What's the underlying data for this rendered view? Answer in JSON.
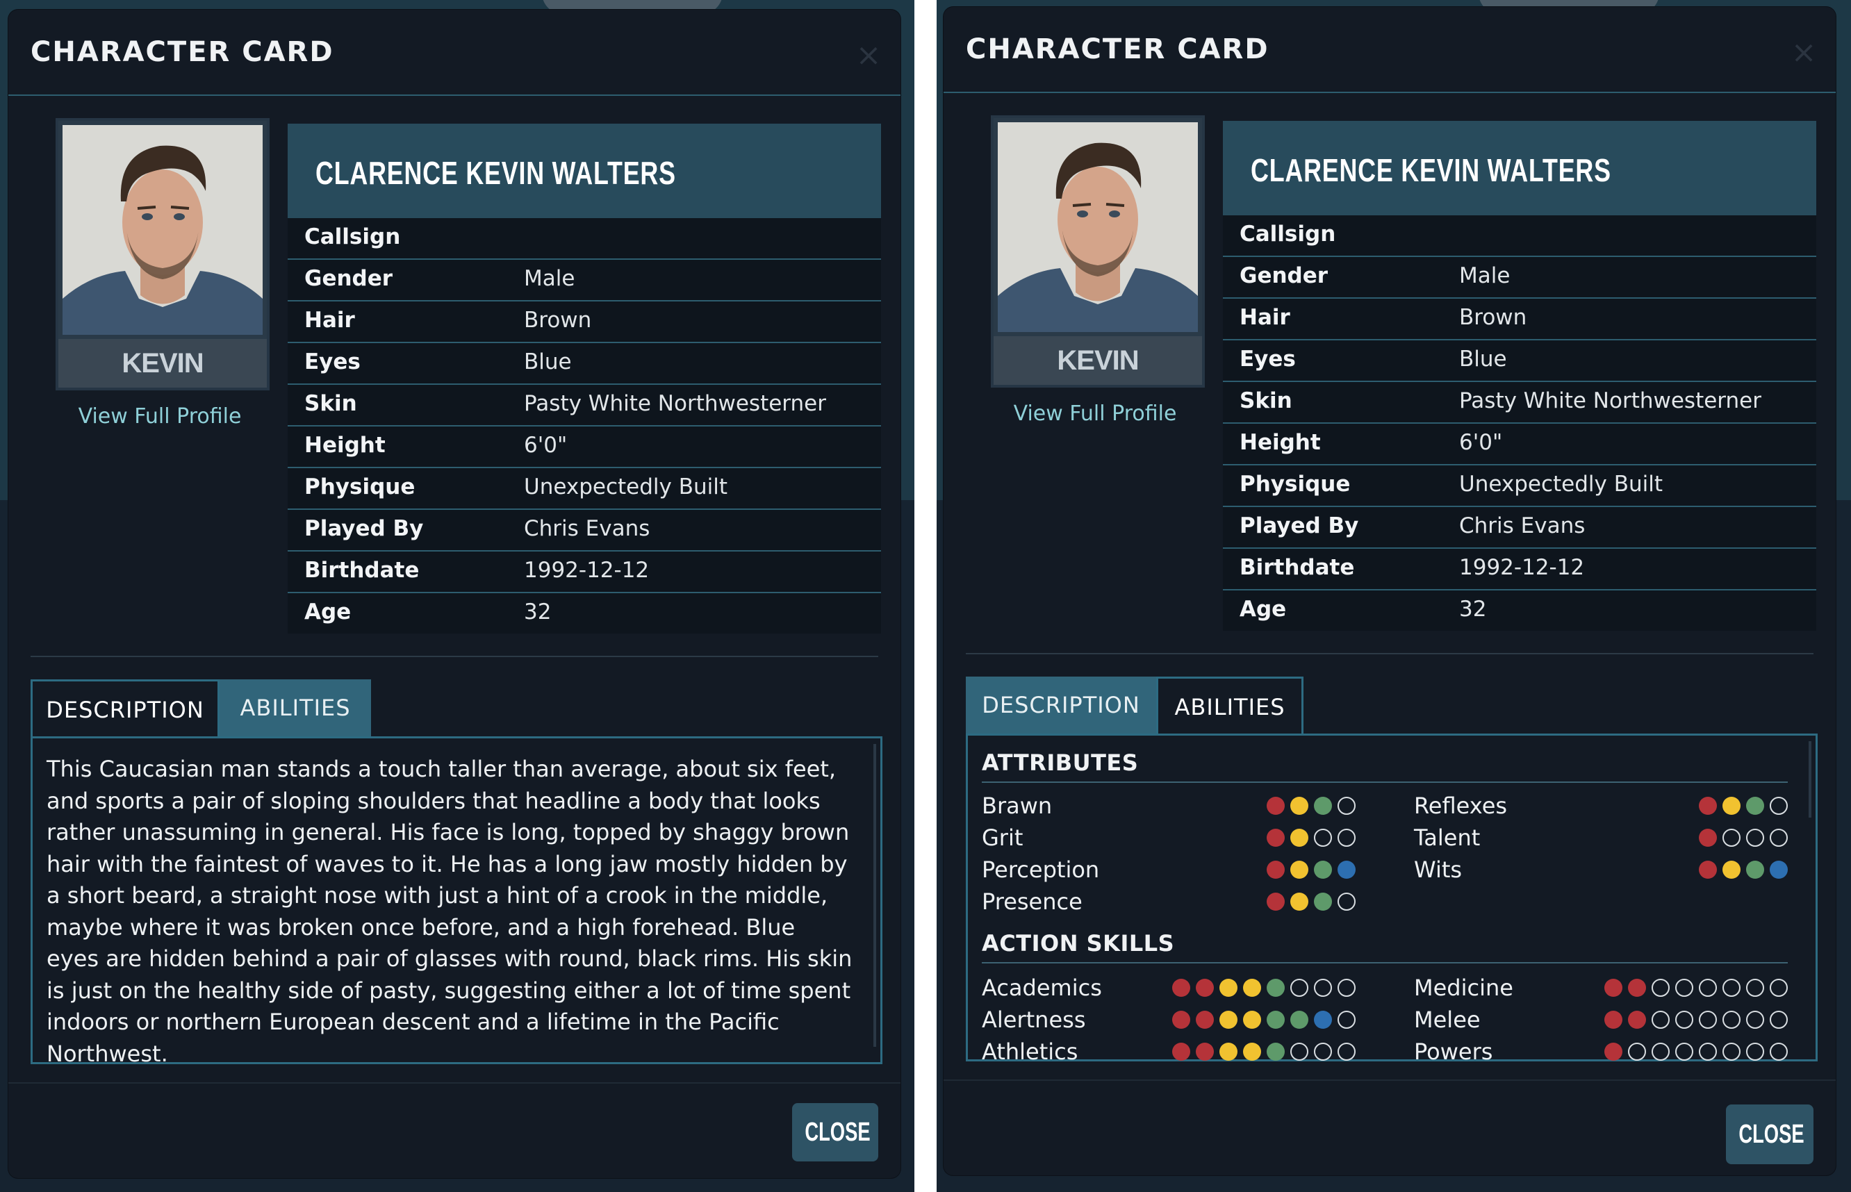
{
  "card": {
    "title": "CHARACTER CARD",
    "close_icon": "×",
    "nickname": "KEVIN",
    "view_profile": "View Full Profile",
    "name": "CLARENCE KEVIN WALTERS",
    "attributes": [
      {
        "label": "Callsign",
        "value": ""
      },
      {
        "label": "Gender",
        "value": "Male"
      },
      {
        "label": "Hair",
        "value": "Brown"
      },
      {
        "label": "Eyes",
        "value": "Blue"
      },
      {
        "label": "Skin",
        "value": "Pasty White Northwesterner"
      },
      {
        "label": "Height",
        "value": "6'0\""
      },
      {
        "label": "Physique",
        "value": "Unexpectedly Built"
      },
      {
        "label": "Played By",
        "value": "Chris Evans"
      },
      {
        "label": "Birthdate",
        "value": "1992-12-12"
      },
      {
        "label": "Age",
        "value": "32"
      }
    ],
    "tabs": {
      "description": "DESCRIPTION",
      "abilities": "ABILITIES"
    },
    "description": "This Caucasian man stands a touch taller than average, about six feet, and sports a pair of sloping shoulders that headline a body that looks rather unassuming in general. His face is long, topped by shaggy brown hair with the faintest of waves to it. He has a long jaw mostly hidden by a short beard, a straight nose with just a hint of a crook in the middle, maybe where it was broken once before, and a high forehead. Blue eyes are hidden behind a pair of glasses with round, black rims. His skin is just on the healthy side of pasty, suggesting either a lot of time spent indoors or northern European descent and a lifetime in the Pacific Northwest.",
    "close_label": "CLOSE"
  },
  "abilities": {
    "attributes_title": "ATTRIBUTES",
    "attributes": [
      {
        "name": "Brawn",
        "dots": [
          "red",
          "yellow",
          "green",
          "empty"
        ]
      },
      {
        "name": "Reflexes",
        "dots": [
          "red",
          "yellow",
          "green",
          "empty"
        ]
      },
      {
        "name": "Grit",
        "dots": [
          "red",
          "yellow",
          "empty",
          "empty"
        ]
      },
      {
        "name": "Talent",
        "dots": [
          "red",
          "empty",
          "empty",
          "empty"
        ]
      },
      {
        "name": "Perception",
        "dots": [
          "red",
          "yellow",
          "green",
          "blue"
        ]
      },
      {
        "name": "Wits",
        "dots": [
          "red",
          "yellow",
          "green",
          "blue"
        ]
      },
      {
        "name": "Presence",
        "dots": [
          "red",
          "yellow",
          "green",
          "empty"
        ]
      }
    ],
    "skills_title": "ACTION SKILLS",
    "skills": [
      {
        "name": "Academics",
        "dots": [
          "red",
          "red",
          "yellow",
          "yellow",
          "green",
          "empty",
          "empty",
          "empty"
        ]
      },
      {
        "name": "Medicine",
        "dots": [
          "red",
          "red",
          "empty",
          "empty",
          "empty",
          "empty",
          "empty",
          "empty"
        ]
      },
      {
        "name": "Alertness",
        "dots": [
          "red",
          "red",
          "yellow",
          "yellow",
          "green",
          "green",
          "blue",
          "empty"
        ]
      },
      {
        "name": "Melee",
        "dots": [
          "red",
          "red",
          "empty",
          "empty",
          "empty",
          "empty",
          "empty",
          "empty"
        ]
      },
      {
        "name": "Athletics",
        "dots": [
          "red",
          "red",
          "yellow",
          "yellow",
          "green",
          "empty",
          "empty",
          "empty"
        ]
      },
      {
        "name": "Powers",
        "dots": [
          "red",
          "empty",
          "empty",
          "empty",
          "empty",
          "empty",
          "empty",
          "empty"
        ]
      }
    ]
  }
}
